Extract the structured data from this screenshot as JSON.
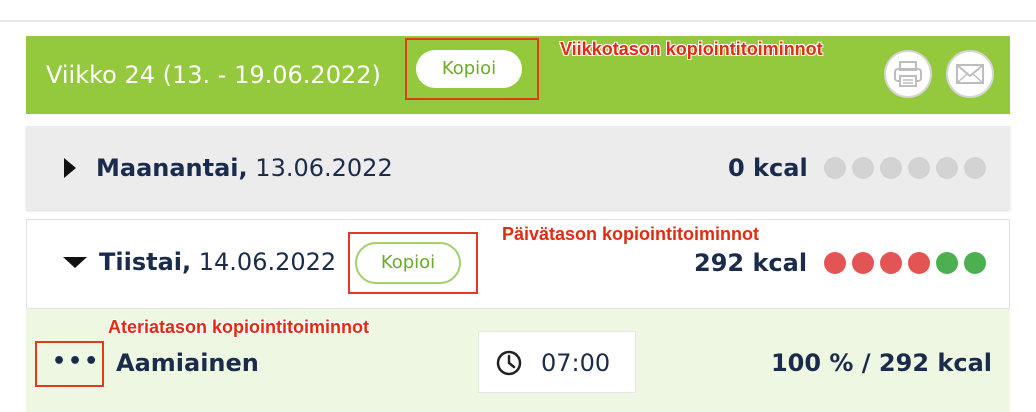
{
  "week": {
    "title": "Viikko 24 (13. - 19.06.2022)",
    "copy_label": "Kopioi",
    "icons": [
      "print-icon",
      "mail-icon"
    ],
    "color": "#95c93d"
  },
  "days": [
    {
      "name": "Maanantai,",
      "date": "13.06.2022",
      "kcal": "0 kcal",
      "expanded": false,
      "dots": [
        "#d3d3d3",
        "#d3d3d3",
        "#d3d3d3",
        "#d3d3d3",
        "#d3d3d3",
        "#d3d3d3"
      ]
    },
    {
      "name": "Tiistai,",
      "date": "14.06.2022",
      "kcal": "292 kcal",
      "expanded": true,
      "copy_label": "Kopioi",
      "dots": [
        "#e35454",
        "#e35454",
        "#e35454",
        "#e35454",
        "#4caf50",
        "#4caf50"
      ]
    }
  ],
  "meal": {
    "more_label": "•••",
    "name": "Aamiainen",
    "time": "07:00",
    "summary": "100 % / 292 kcal"
  },
  "annotations": {
    "week": "Viikkotason kopiointitoiminnot",
    "day": "Päivätason kopiointitoiminnot",
    "meal": "Ateriatason kopiointitoiminnot",
    "color": "#e32b12"
  }
}
